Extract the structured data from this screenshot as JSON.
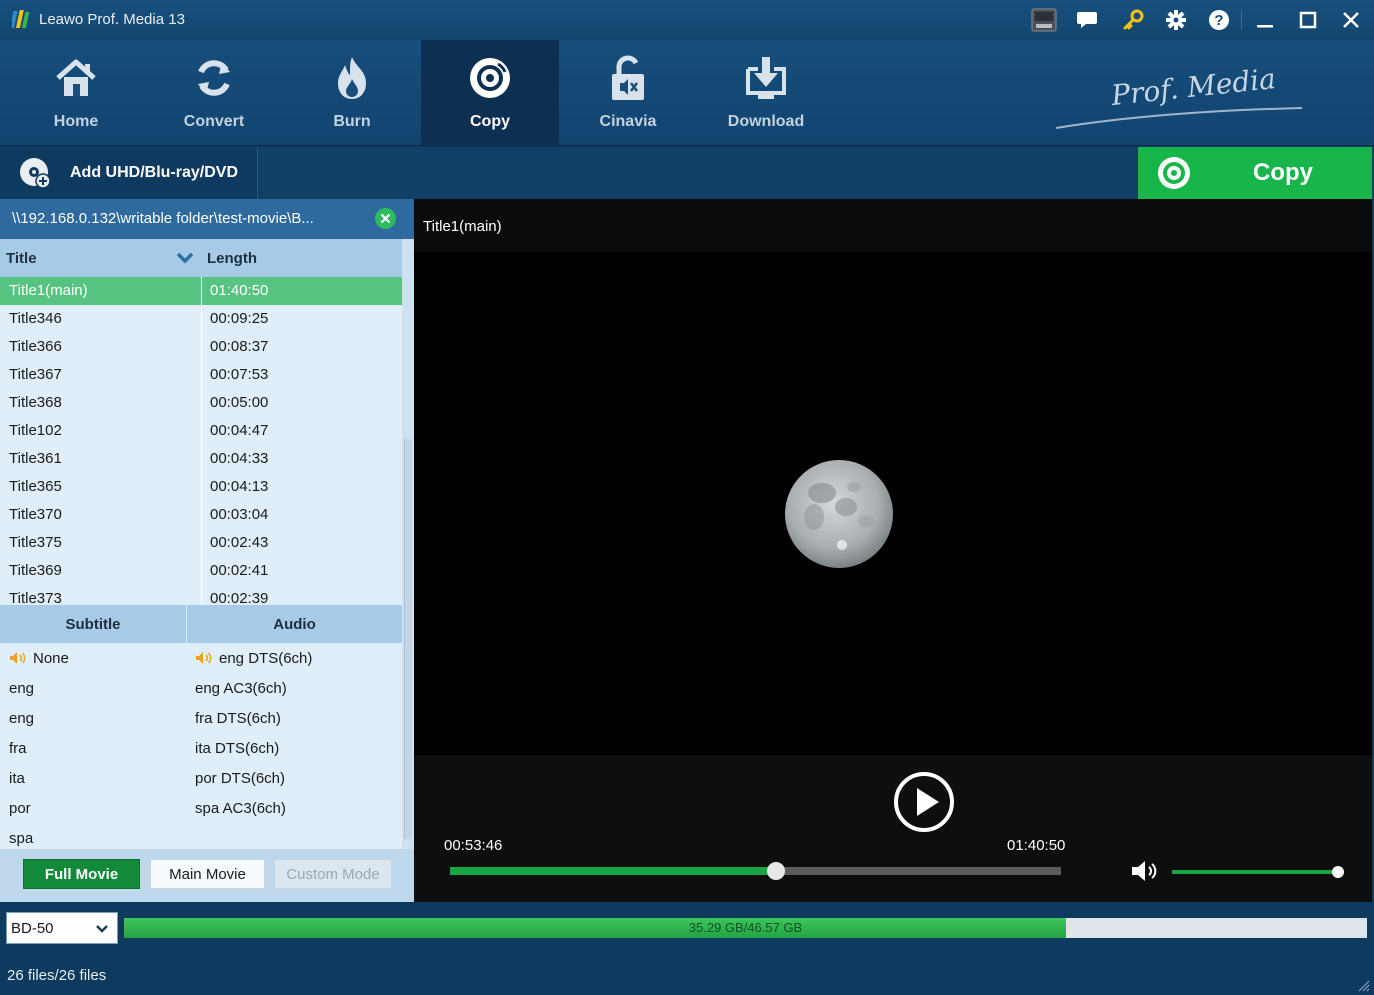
{
  "window": {
    "title": "Leawo Prof. Media 13",
    "brand": "Prof. Media"
  },
  "titlebar_icons": [
    "amd-icon",
    "chat-icon",
    "key-icon",
    "gear-icon",
    "help-icon",
    "minimize-icon",
    "maximize-icon",
    "close-icon"
  ],
  "nav": {
    "items": [
      {
        "label": "Home",
        "icon": "home-icon"
      },
      {
        "label": "Convert",
        "icon": "convert-icon"
      },
      {
        "label": "Burn",
        "icon": "flame-icon"
      },
      {
        "label": "Copy",
        "icon": "disc-icon",
        "active": true
      },
      {
        "label": "Cinavia",
        "icon": "cinavia-icon"
      },
      {
        "label": "Download",
        "icon": "download-icon"
      }
    ]
  },
  "actions": {
    "add_label": "Add UHD/Blu-ray/DVD",
    "copy_label": "Copy"
  },
  "source": {
    "path": "\\\\192.168.0.132\\writable folder\\test-movie\\B..."
  },
  "titles": {
    "header": {
      "title": "Title",
      "length": "Length"
    },
    "rows": [
      {
        "title": "Title1(main)",
        "length": "01:40:50",
        "selected": true
      },
      {
        "title": "Title346",
        "length": "00:09:25"
      },
      {
        "title": "Title366",
        "length": "00:08:37"
      },
      {
        "title": "Title367",
        "length": "00:07:53"
      },
      {
        "title": "Title368",
        "length": "00:05:00"
      },
      {
        "title": "Title102",
        "length": "00:04:47"
      },
      {
        "title": "Title361",
        "length": "00:04:33"
      },
      {
        "title": "Title365",
        "length": "00:04:13"
      },
      {
        "title": "Title370",
        "length": "00:03:04"
      },
      {
        "title": "Title375",
        "length": "00:02:43"
      },
      {
        "title": "Title369",
        "length": "00:02:41"
      },
      {
        "title": "Title373",
        "length": "00:02:39"
      }
    ]
  },
  "tracks": {
    "subtitle_header": "Subtitle",
    "audio_header": "Audio",
    "subtitles": [
      {
        "label": "None",
        "active": true
      },
      {
        "label": "eng"
      },
      {
        "label": "eng"
      },
      {
        "label": "fra"
      },
      {
        "label": "ita"
      },
      {
        "label": "por"
      },
      {
        "label": "spa"
      }
    ],
    "audios": [
      {
        "label": "eng DTS(6ch)",
        "active": true
      },
      {
        "label": "eng AC3(6ch)"
      },
      {
        "label": "fra DTS(6ch)"
      },
      {
        "label": "ita DTS(6ch)"
      },
      {
        "label": "por DTS(6ch)"
      },
      {
        "label": "spa AC3(6ch)"
      }
    ]
  },
  "modes": {
    "full": "Full Movie",
    "main": "Main Movie",
    "custom": "Custom Mode",
    "selected": "Full Movie"
  },
  "player": {
    "title": "Title1(main)",
    "current_time": "00:53:46",
    "total_time": "01:40:50",
    "progress_fraction": 0.533,
    "volume_fraction": 1.0
  },
  "output": {
    "disc_type": "BD-50",
    "capacity_text": "35.29 GB/46.57 GB",
    "capacity_fraction": 0.758,
    "files_text": "26 files/26 files"
  },
  "colors": {
    "accent_green": "#18b64a",
    "selected_row": "#56c480",
    "nav_bg": "#174e7c"
  }
}
